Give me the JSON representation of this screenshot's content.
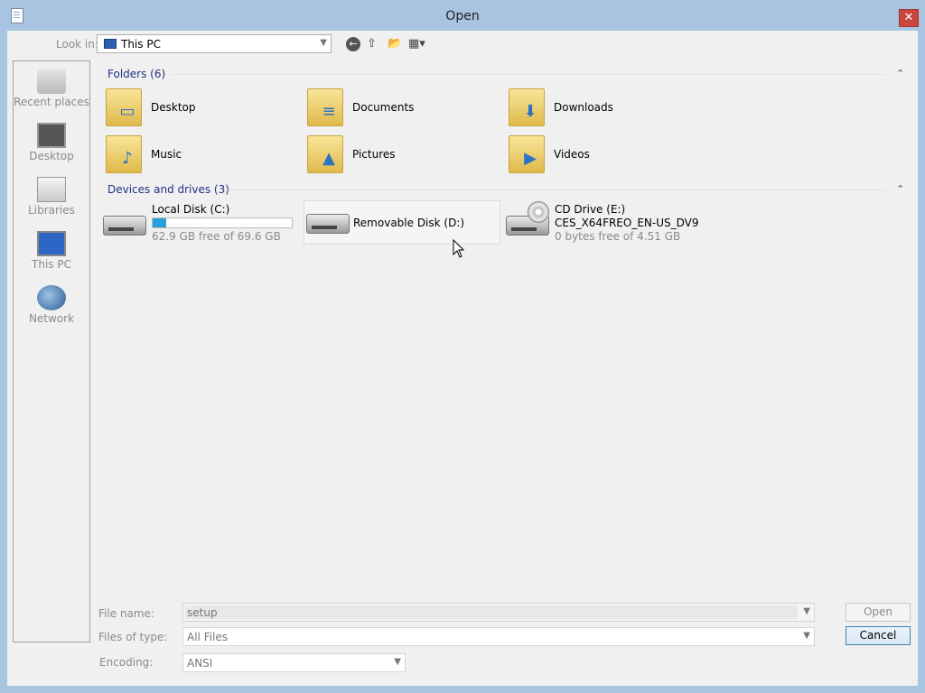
{
  "window": {
    "title": "Open",
    "close_glyph": "✕"
  },
  "toolbar": {
    "look_in_label": "Look in:",
    "look_in_value": "This PC",
    "back_glyph": "←",
    "up_glyph": "⇧",
    "new_folder_glyph": "📂",
    "view_glyph": "▦▾"
  },
  "places": [
    {
      "label": "Recent places",
      "icon": "recent-places-icon"
    },
    {
      "label": "Desktop",
      "icon": "desktop-icon"
    },
    {
      "label": "Libraries",
      "icon": "libraries-icon"
    },
    {
      "label": "This PC",
      "icon": "this-pc-icon"
    },
    {
      "label": "Network",
      "icon": "network-icon"
    }
  ],
  "folders_group": {
    "header": "Folders (6)",
    "collapse_glyph": "⌃"
  },
  "folders": [
    {
      "name": "Desktop",
      "badge": "▭"
    },
    {
      "name": "Documents",
      "badge": "≡"
    },
    {
      "name": "Downloads",
      "badge": "⬇"
    },
    {
      "name": "Music",
      "badge": "♪"
    },
    {
      "name": "Pictures",
      "badge": "▲"
    },
    {
      "name": "Videos",
      "badge": "▶"
    }
  ],
  "drives_group": {
    "header": "Devices and drives (3)",
    "collapse_glyph": "⌃"
  },
  "drives": {
    "c": {
      "name": "Local Disk (C:)",
      "free": "62.9 GB free of 69.6 GB",
      "used_fraction": 0.096
    },
    "d": {
      "name": "Removable Disk (D:)"
    },
    "e": {
      "name": "CD Drive (E:)",
      "label": "CES_X64FREO_EN-US_DV9",
      "free": "0 bytes free of 4.51 GB"
    }
  },
  "form": {
    "file_name_label": "File name:",
    "file_name_value": "setup",
    "files_of_type_label": "Files of type:",
    "files_of_type_value": "All Files",
    "encoding_label": "Encoding:",
    "encoding_value": "ANSI",
    "open_label": "Open",
    "cancel_label": "Cancel"
  },
  "colors": {
    "title_bar": "#a9c4e0",
    "group_header": "#1e3287",
    "drive_bar": "#26a0da",
    "close": "#c9463d"
  }
}
